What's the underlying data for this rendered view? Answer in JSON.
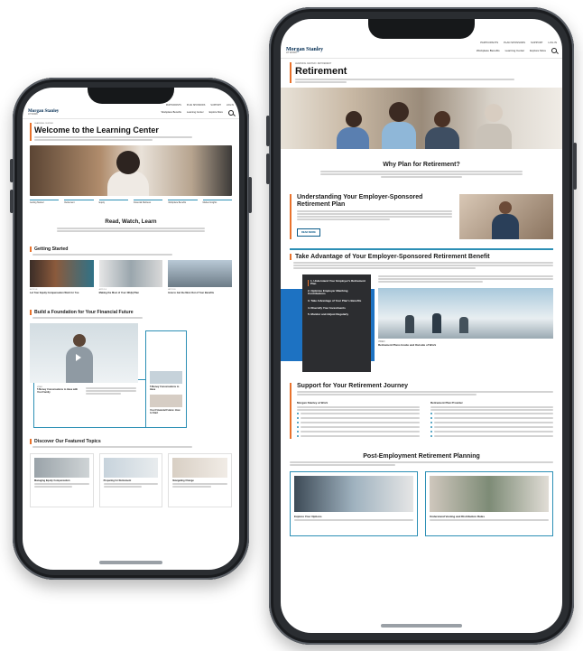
{
  "brand": {
    "name": "Morgan Stanley",
    "sub": "AT WORK",
    "accent": "#e8722c",
    "teal": "#2c8fb5",
    "navy": "#002b51"
  },
  "left_phone": {
    "topbar": [
      "Participants",
      "Plan Sponsors",
      "Support",
      "Log In"
    ],
    "nav": [
      "Workplace Benefits",
      "Learning Center",
      "Explore More"
    ],
    "eyebrow": "Learning Center",
    "title": "Welcome to the Learning Center",
    "pill_nav": [
      "Getting Started",
      "Retirement",
      "Equity",
      "Financial Wellness",
      "Workplace Benefits",
      "Market Insights"
    ],
    "read_watch_learn": "Read, Watch, Learn",
    "getting_started": {
      "title": "Getting Started",
      "cards": [
        {
          "tag": "Article",
          "title": "Let Your Equity Compensation Work for You"
        },
        {
          "tag": "Article",
          "title": "Making the Most of Your 401(k) Plan"
        },
        {
          "tag": "Article",
          "title": "How to Get the Most Out of Your Benefits"
        }
      ]
    },
    "foundation": {
      "title": "Build a Foundation for Your Financial Future",
      "video_caption": "5 Money Conversations to Have with Your Family",
      "video_tag": "Video",
      "side_items": [
        "5 Money Conversations to Have",
        "Your Financial Future: How to Start"
      ]
    },
    "featured": {
      "title": "Discover Our Featured Topics",
      "cards": [
        "Managing Equity Compensation",
        "Preparing for Retirement",
        "Navigating Change"
      ]
    }
  },
  "right_phone": {
    "topbar": [
      "Participants",
      "Plan Sponsors",
      "Support",
      "Log In"
    ],
    "nav": [
      "Workplace Benefits",
      "Learning Center",
      "Explore More"
    ],
    "eyebrow": "Learning Center / Retirement",
    "title": "Retirement",
    "why_title": "Why Plan for Retirement?",
    "understanding": {
      "title": "Understanding Your Employer-Sponsored Retirement Plan",
      "button": "READ MORE"
    },
    "take_advantage": {
      "title": "Take Advantage of Your Employer-Sponsored Retirement Benefit",
      "steps": [
        "1. Understand Your Employer's Retirement Plan",
        "2. Optimize Employer Matching Contributions",
        "3. Take Advantage of Your Plan's Benefits",
        "4. Diversify Your Investments",
        "5. Monitor and Adjust Regularly"
      ],
      "media_tag": "Video",
      "media_title": "Retirement Plans Inside and Outside of Work"
    },
    "support": {
      "title": "Support for Your Retirement Journey",
      "col1": {
        "title": "Morgan Stanley at Work",
        "bullets": 6
      },
      "col2": {
        "title": "Retirement Plan Provider",
        "bullets": 6
      }
    },
    "post_employment": {
      "title": "Post-Employment Retirement Planning",
      "cards": [
        "Explore Your Options",
        "Understand Vesting and Distribution Rules"
      ]
    }
  }
}
